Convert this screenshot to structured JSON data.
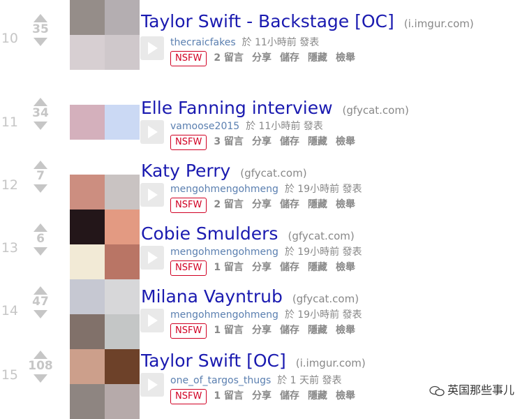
{
  "nsfw_label": "NSFW",
  "actions": {
    "save": "儲存",
    "hide": "隱藏",
    "report": "檢舉"
  },
  "watermark": {
    "text": "英国那些事儿",
    "icon": "wechat-icon"
  },
  "posts": [
    {
      "rank": "10",
      "score": "35",
      "title": "Taylor Swift - Backstage [OC]",
      "domain": "(i.imgur.com)",
      "author": "thecraicfakes",
      "time": "於 11小時前 發表",
      "comments": "2 留言",
      "share": "分享"
    },
    {
      "rank": "11",
      "score": "34",
      "title": "Elle Fanning interview",
      "domain": "(gfycat.com)",
      "author": "vamoose2015",
      "time": "於 11小時前 發表",
      "comments": "3 留言",
      "share": "分享"
    },
    {
      "rank": "12",
      "score": "7",
      "title": "Katy Perry",
      "domain": "(gfycat.com)",
      "author": "mengohmengohmeng",
      "time": "於 19小時前 發表",
      "comments": "2 留言",
      "share": "分享"
    },
    {
      "rank": "13",
      "score": "6",
      "title": "Cobie Smulders",
      "domain": "(gfycat.com)",
      "author": "mengohmengohmeng",
      "time": "於 19小時前 發表",
      "comments": "1 留言",
      "share": "分享"
    },
    {
      "rank": "14",
      "score": "47",
      "title": "Milana Vayntrub",
      "domain": "(gfycat.com)",
      "author": "mengohmengohmeng",
      "time": "於 19小時前 發表",
      "comments": "1 留言",
      "share": "分享"
    },
    {
      "rank": "15",
      "score": "108",
      "title": "Taylor Swift [OC]",
      "domain": "(i.imgur.com)",
      "author": "one_of_targos_thugs",
      "time": "於 1 天前 發表",
      "comments": "1 留言",
      "share": "分享"
    }
  ],
  "thumb_colors": [
    [
      "#958d89",
      "#b4aeb1",
      "#d7cfd2",
      "#cfc8cb"
    ],
    [
      "#ffffff",
      "#ffffff",
      "#d4b0bc",
      "#cbd9f4"
    ],
    [
      "#ffffff",
      "#ffffff",
      "#cc8e80",
      "#c9c3c2"
    ],
    [
      "#231619",
      "#e39a82",
      "#f2ead6",
      "#b97565"
    ],
    [
      "#c6c8d2",
      "#d7d7d9",
      "#81716a",
      "#c4c6c6"
    ],
    [
      "#cc9f8b",
      "#6d4129",
      "#8e8581",
      "#b6aaaa"
    ]
  ]
}
